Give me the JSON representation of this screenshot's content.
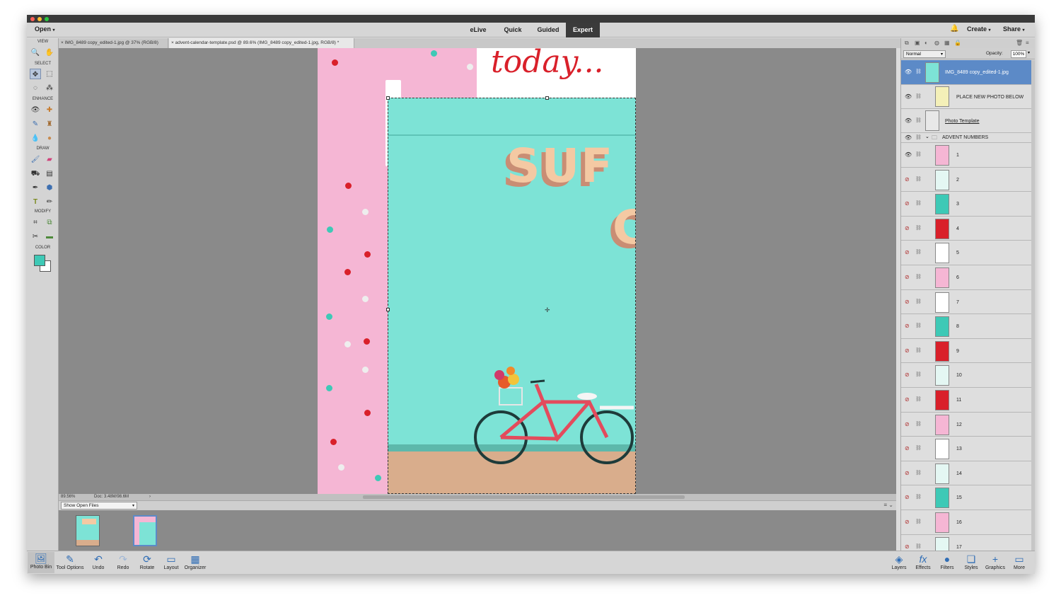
{
  "topbar": {
    "open_label": "Open",
    "modes": [
      "eLive",
      "Quick",
      "Guided",
      "Expert"
    ],
    "active_mode": "Expert",
    "create_label": "Create",
    "share_label": "Share"
  },
  "doc_tabs": [
    {
      "label": "IMG_8489 copy_edited-1.jpg @ 37% (RGB/8)",
      "active": false
    },
    {
      "label": "advent-calendar-template.psd @ 89.6% (IMG_8489 copy_edited-1.jpg, RGB/8) *",
      "active": true
    }
  ],
  "toolbox": {
    "sections": [
      "VIEW",
      "SELECT",
      "ENHANCE",
      "DRAW",
      "MODIFY",
      "COLOR"
    ],
    "foreground_color": "#3ec9b6",
    "background_color": "#ffffff"
  },
  "canvas": {
    "headline": "today...",
    "sign_text_line1": "SUF",
    "sign_text_line2": "C",
    "accent_colors": {
      "pink": "#f5b6d4",
      "teal": "#7de3d6",
      "red": "#d9202a"
    }
  },
  "status": {
    "zoom": "89.56%",
    "doc_size": "Doc: 3.48M/98.6M"
  },
  "photo_bin": {
    "filter_label": "Show Open Files"
  },
  "bottom_bar": {
    "left": [
      "Photo Bin",
      "Tool Options",
      "Undo",
      "Redo",
      "Rotate",
      "Layout",
      "Organizer"
    ],
    "right": [
      "Layers",
      "Effects",
      "Filters",
      "Styles",
      "Graphics",
      "More"
    ]
  },
  "layers_panel": {
    "blend_mode": "Normal",
    "opacity_label": "Opacity:",
    "opacity_value": "100%",
    "layers": [
      {
        "name": "IMG_8489 copy_edited-1.jpg",
        "selected": true,
        "visible": true
      },
      {
        "name": "PLACE NEW PHOTO BELOW",
        "selected": false,
        "visible": true
      },
      {
        "name": "Photo Template",
        "selected": false,
        "visible": true
      },
      {
        "name": "ADVENT NUMBERS",
        "selected": false,
        "visible": true,
        "group": true
      },
      {
        "name": "1",
        "visible": true
      },
      {
        "name": "2",
        "visible": false
      },
      {
        "name": "3",
        "visible": false
      },
      {
        "name": "4",
        "visible": false
      },
      {
        "name": "5",
        "visible": false
      },
      {
        "name": "6",
        "visible": false
      },
      {
        "name": "7",
        "visible": false
      },
      {
        "name": "8",
        "visible": false
      },
      {
        "name": "9",
        "visible": false
      },
      {
        "name": "10",
        "visible": false
      },
      {
        "name": "11",
        "visible": false
      },
      {
        "name": "12",
        "visible": false
      },
      {
        "name": "13",
        "visible": false
      },
      {
        "name": "14",
        "visible": false
      },
      {
        "name": "15",
        "visible": false
      },
      {
        "name": "16",
        "visible": false
      },
      {
        "name": "17",
        "visible": false
      }
    ]
  }
}
